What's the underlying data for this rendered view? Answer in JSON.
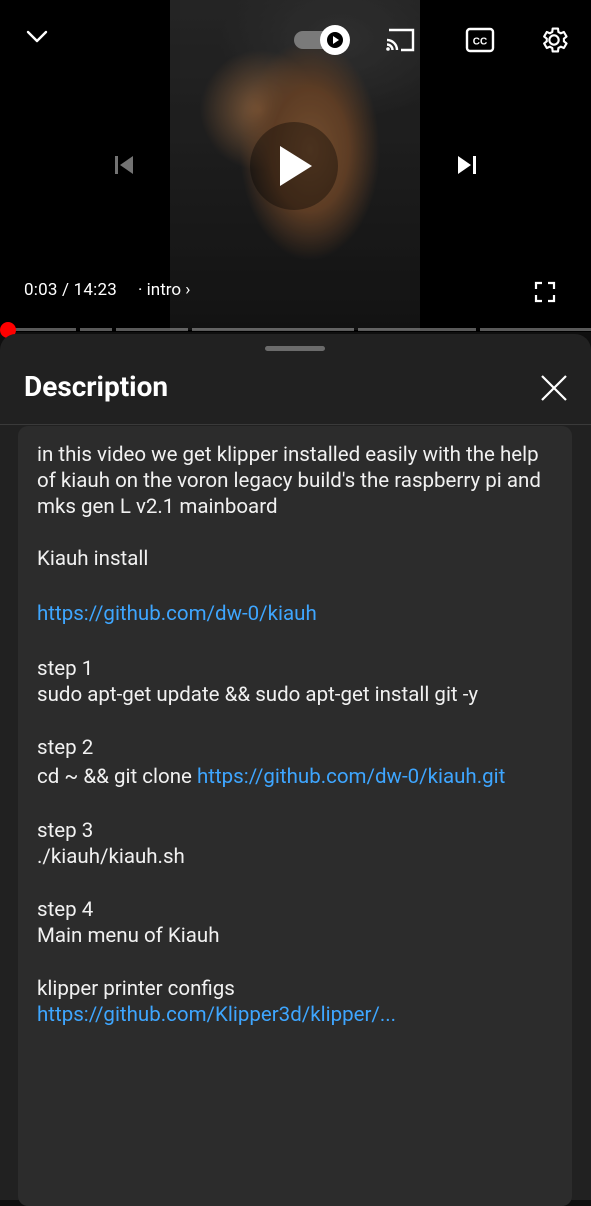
{
  "player": {
    "time_current": "0:03",
    "time_total": "14:23",
    "time_separator": " / ",
    "chapter_label": "intro",
    "chapter_chevron": "›",
    "colors": {
      "progress": "#ff0000",
      "segment": "#ffffff",
      "background": "#000000"
    }
  },
  "description": {
    "title": "Description",
    "intro": "in this video we get klipper installed easily with the help of kiauh on the voron legacy build's the raspberry pi and mks gen L v2.1 mainboard",
    "kiauh_label": "Kiauh install",
    "kiauh_link": "https://github.com/dw-0/kiauh",
    "step1_title": "step 1",
    "step1_cmd": "sudo apt-get update && sudo apt-get install git -y",
    "step2_title": "step 2",
    "step2_prefix": "cd ~ && git clone ",
    "step2_link": "https://github.com/dw-0/kiauh.git",
    "step3_title": "step 3",
    "step3_cmd": "./kiauh/kiauh.sh",
    "step4_title": "step 4",
    "step4_text": "Main menu of Kiauh",
    "configs_label": "klipper printer configs",
    "configs_link": "https://github.com/Klipper3d/klipper/...",
    "colors": {
      "panel": "#212121",
      "card": "#2c2c2c",
      "link": "#3ea6ff"
    }
  },
  "icons": [
    "chevron-down-icon",
    "autoplay-toggle",
    "cast-icon",
    "captions-icon",
    "gear-icon",
    "previous-icon",
    "play-icon",
    "next-icon",
    "fullscreen-icon",
    "close-icon"
  ]
}
